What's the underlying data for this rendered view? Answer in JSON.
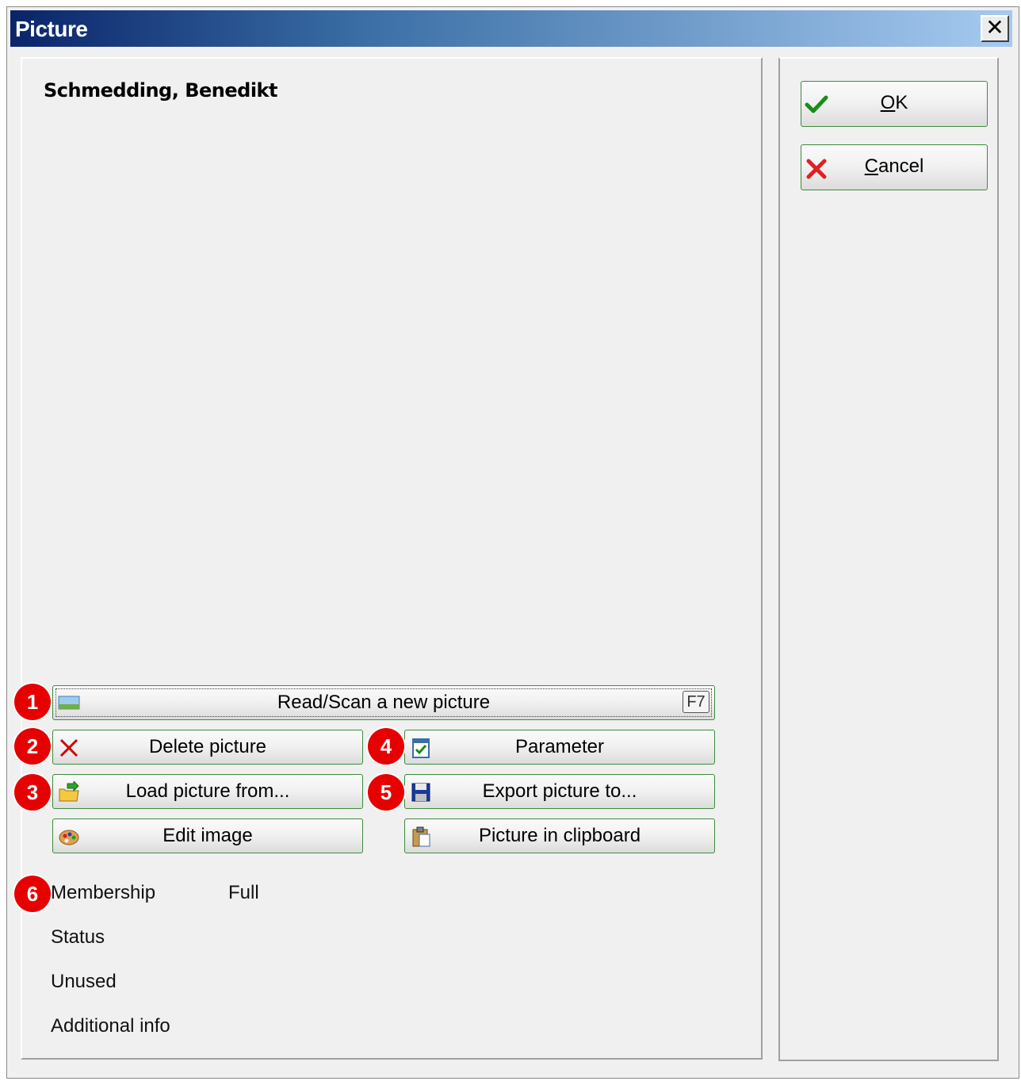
{
  "window": {
    "title": "Picture",
    "close_label": "✕"
  },
  "person": {
    "name": "Schmedding, Benedikt"
  },
  "dialog_buttons": {
    "ok": {
      "underline": "O",
      "rest": "K"
    },
    "cancel": {
      "underline": "C",
      "rest": "ancel"
    }
  },
  "actions": {
    "read_scan": {
      "label": "Read/Scan a new picture",
      "shortcut": "F7"
    },
    "delete": {
      "label": "Delete picture"
    },
    "load": {
      "label": "Load picture from..."
    },
    "edit": {
      "label": "Edit image"
    },
    "parameter": {
      "label": "Parameter"
    },
    "export": {
      "label": "Export picture to..."
    },
    "clipboard": {
      "label": "Picture in clipboard"
    }
  },
  "badges": [
    "1",
    "2",
    "3",
    "4",
    "5",
    "6"
  ],
  "info": {
    "membership_label": "Membership",
    "membership_value": "Full",
    "status_label": "Status",
    "unused_label": "Unused",
    "additional_label": "Additional info"
  },
  "colors": {
    "badge": "#e60000",
    "button_border": "#3c8c3c",
    "title_gradient_start": "#0a246a",
    "title_gradient_end": "#a6caf0"
  }
}
